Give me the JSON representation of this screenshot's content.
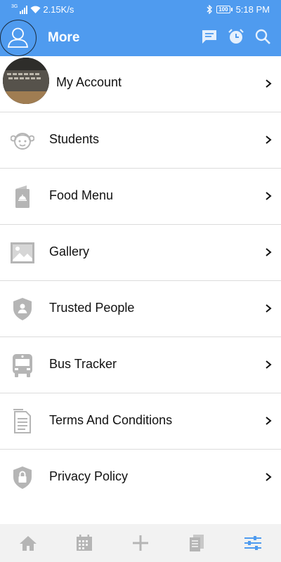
{
  "status_bar": {
    "network_tag": "3G",
    "speed": "2.15K/s",
    "battery": "100",
    "time": "5:18 PM"
  },
  "app_bar": {
    "title": "More",
    "actions": [
      "chat-icon",
      "alarm-icon",
      "search-icon"
    ]
  },
  "menu": {
    "items": [
      {
        "label": "My Account",
        "icon": "account-photo"
      },
      {
        "label": "Students",
        "icon": "child-face-icon"
      },
      {
        "label": "Food Menu",
        "icon": "food-menu-icon"
      },
      {
        "label": "Gallery",
        "icon": "gallery-icon"
      },
      {
        "label": "Trusted People",
        "icon": "shield-person-icon"
      },
      {
        "label": "Bus Tracker",
        "icon": "bus-icon"
      },
      {
        "label": "Terms And Conditions",
        "icon": "document-icon"
      },
      {
        "label": "Privacy Policy",
        "icon": "shield-lock-icon"
      }
    ]
  },
  "bottom_nav": {
    "items": [
      "home-icon",
      "calendar-icon",
      "add-icon",
      "notes-icon",
      "settings-sliders-icon"
    ],
    "active_index": 4
  },
  "colors": {
    "primary": "#4f9bef",
    "icon_gray": "#b5b5b5",
    "divider": "#dcdcdc",
    "active_nav": "#4f9bef"
  }
}
